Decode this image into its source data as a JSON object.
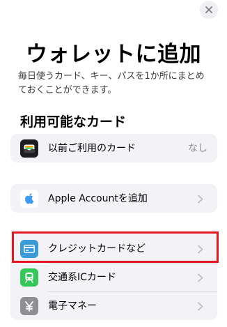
{
  "header": {
    "close_icon": "close-icon",
    "title": "ウォレットに追加",
    "subtitle": "毎日使うカード、キー、パスを1か所にまとめておくことができます。"
  },
  "section": {
    "header": "利用可能なカード"
  },
  "cards": {
    "previous": {
      "icon": "wallet-icon",
      "label": "以前ご利用のカード",
      "value": "なし"
    },
    "apple_account": {
      "icon": "apple-icon",
      "label": "Apple Accountを追加"
    },
    "credit": {
      "icon": "credit-card-icon",
      "label": "クレジットカードなど",
      "icon_color": "#3b9ad8"
    },
    "transit": {
      "icon": "train-icon",
      "label": "交通系ICカード",
      "icon_color": "#34c759"
    },
    "emoney": {
      "icon": "yen-icon",
      "label": "電子マネー",
      "icon_color": "#8e8e93"
    }
  },
  "colors": {
    "highlight": "#e3171f",
    "card_background": "#f2f2f7"
  }
}
